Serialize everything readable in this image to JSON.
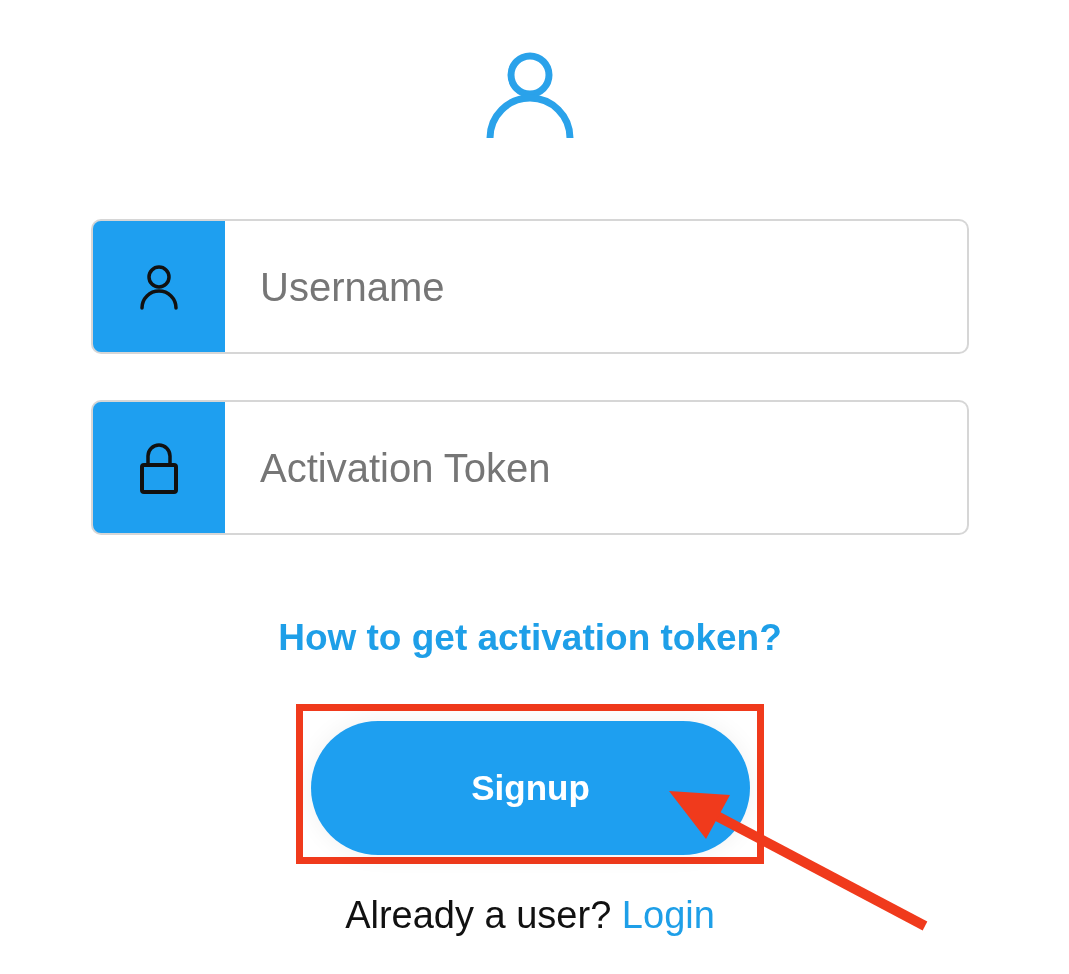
{
  "fields": [
    {
      "kind": "user",
      "placeholder": "Username"
    },
    {
      "kind": "lock",
      "placeholder": "Activation Token"
    }
  ],
  "help_link": "How to get activation token?",
  "signup_button": {
    "label": "Signup",
    "highlighted": true,
    "arrow": true
  },
  "login_prompt": {
    "text": "Already a user?",
    "link": "Login"
  }
}
